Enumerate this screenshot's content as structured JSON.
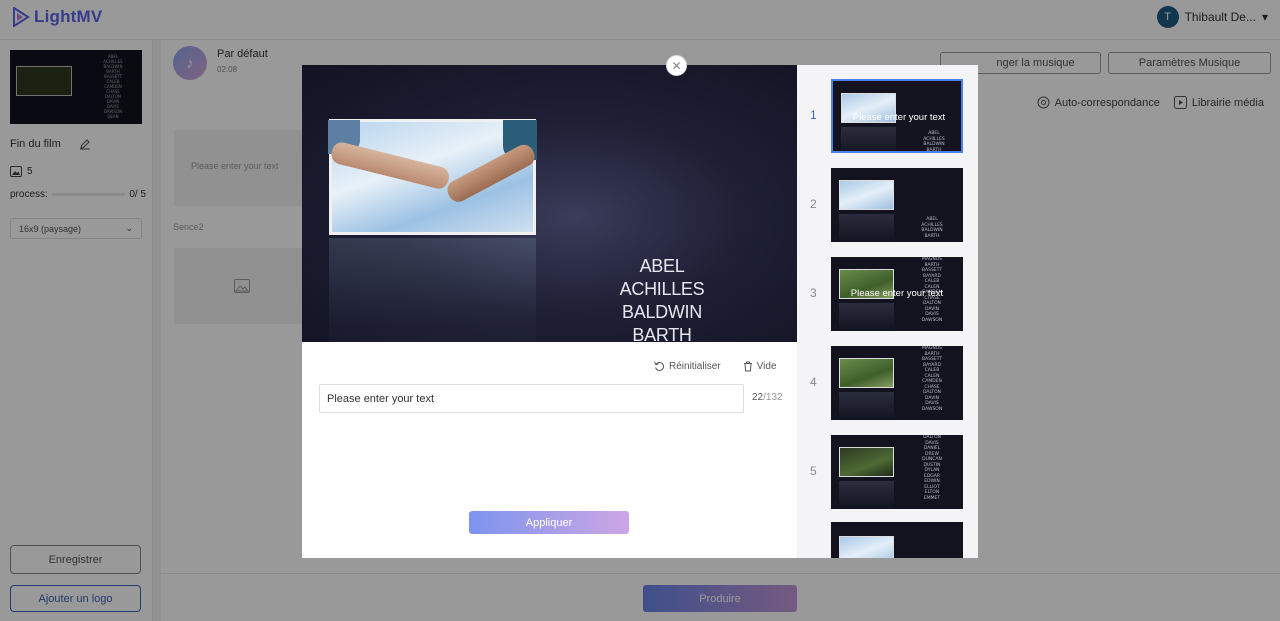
{
  "app": {
    "logo_text": "LightMV",
    "brand_color": "#5b63e8",
    "user_initial": "T",
    "user_name": "Thibault De..."
  },
  "sidebar": {
    "film_title": "Fin du film",
    "photo_count": "5",
    "process_label": "process:",
    "process_value": "0/ 5",
    "ratio_selected": "16x9 (paysage)",
    "save_label": "Enregistrer",
    "logo_label": "Ajouter un logo"
  },
  "main": {
    "music_name": "Par défaut",
    "music_time": "02:08",
    "change_music_label": "nger la musique",
    "music_settings_label": "Paramètres Musique",
    "auto_match_label": "Auto-correspondance",
    "media_library_label": "Librairie média",
    "scene1_placeholder": "Please enter your text",
    "scene2_label": "Sence2",
    "produce_label": "Produire"
  },
  "modal": {
    "credits": [
      "ABEL",
      "ACHILLES",
      "BALDWIN",
      "BARTH"
    ],
    "reset_label": "Réinitialiser",
    "clear_label": "Vide",
    "text_value": "Please enter your text",
    "counter_current": "22",
    "counter_max": "/132",
    "apply_label": "Appliquer",
    "scenes": [
      {
        "num": "1",
        "active": true,
        "overlay_text": "Please enter your text",
        "list": [
          "ABEL",
          "ACHILLES",
          "BALDWIN",
          "BARTH"
        ]
      },
      {
        "num": "2",
        "active": false,
        "overlay_text": "",
        "list": [
          "ABEL",
          "ACHILLES",
          "BALDWIN",
          "BARTH"
        ]
      },
      {
        "num": "3",
        "active": false,
        "overlay_text": "Please enter your text",
        "list": [
          "MAGNUS",
          "BARTH",
          "BASSETT",
          "BAYARD",
          "CALEB",
          "CALEN",
          "CAMDEN",
          "CHASE",
          "DALTON",
          "DAVIN",
          "DAVIS",
          "DAWSON"
        ]
      },
      {
        "num": "4",
        "active": false,
        "overlay_text": "",
        "list": [
          "MAGNUS",
          "BARTH",
          "BASSETT",
          "BAYARD",
          "CALEB",
          "CALEN",
          "CAMDEN",
          "CHASE",
          "DALTON",
          "DAVIN",
          "DAVIS",
          "DAWSON"
        ]
      },
      {
        "num": "5",
        "active": false,
        "overlay_text": "",
        "list": [
          "DALTON",
          "DAVIS",
          "DANIEL",
          "DREW",
          "DUNCAN",
          "DUSTIN",
          "DYLAN",
          "EDGAR",
          "EDWIN",
          "ELLIOT",
          "ELTON",
          "EMMET"
        ]
      }
    ],
    "accent_color": "#3a63d8"
  }
}
